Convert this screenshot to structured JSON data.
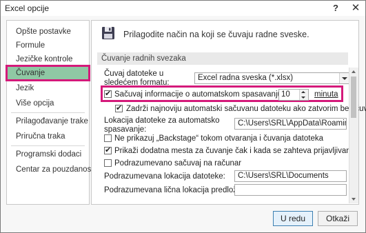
{
  "window": {
    "title": "Excel opcije"
  },
  "sidebar": {
    "items": [
      "Opšte postavke",
      "Formule",
      "Jezičke kontrole",
      "Čuvanje",
      "Jezik",
      "Više opcija",
      "Prilagođavanje trake",
      "Priručna traka",
      "Programski dodaci",
      "Centar za pouzdanost"
    ],
    "selected": "Čuvanje"
  },
  "content": {
    "header": "Prilagodite način na koji se čuvaju radne sveske.",
    "section": "Čuvanje radnih svezaka",
    "format_label": "Čuvaj datoteke u sledećem formatu:",
    "format_value": "Excel radna sveska (*.xlsx)",
    "autosave_label": "Sačuvaj informacije o automatskom spasavanju svakih",
    "autosave_minutes": "10",
    "autosave_unit": "minuta",
    "keep_last_label": "Zadrži najnoviju automatski sačuvanu datoteku ako zatvorim bez čuvanja",
    "autorecover_label": "Lokacija datoteke za automatsko spasavanje:",
    "autorecover_path": "C:\\Users\\SRL\\AppData\\Roaming\\Microsoft\\Excel\\",
    "no_backstage_label": "Ne prikazuj „Backstage“ tokom otvaranja i čuvanja datoteka",
    "show_additional_label": "Prikaži dodatna mesta za čuvanje čak i kada se zahteva prijavljivanje.",
    "save_to_computer_label": "Podrazumevano sačuvaj na računar",
    "default_local_label": "Podrazumevana lokacija datoteke:",
    "default_local_path": "C:\\Users\\SRL\\Documents",
    "default_templates_label": "Podrazumevana lična lokacija predložaka:",
    "default_templates_path": ""
  },
  "buttons": {
    "ok": "U redu",
    "cancel": "Otkaži"
  },
  "colors": {
    "highlight": "#d4197a",
    "selected_bg": "#8fc8a4"
  }
}
